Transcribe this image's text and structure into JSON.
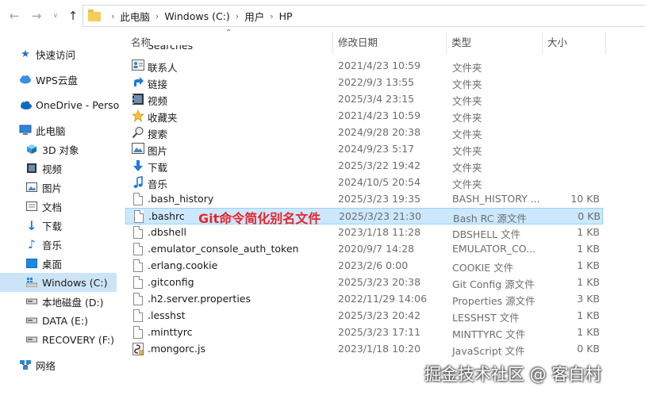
{
  "address_bar": {
    "crumbs": [
      "此电脑",
      "Windows (C:)",
      "用户",
      "HP"
    ]
  },
  "sidebar": {
    "items": [
      {
        "label": "快速访问",
        "icon": "pin-star-icon"
      },
      {
        "label": "WPS云盘",
        "icon": "cloud-icon"
      },
      {
        "label": "OneDrive - Perso",
        "icon": "onedrive-icon"
      },
      {
        "label": "此电脑",
        "icon": "computer-icon"
      },
      {
        "label": "3D 对象",
        "icon": "cube-3d-icon"
      },
      {
        "label": "视频",
        "icon": "video-icon"
      },
      {
        "label": "图片",
        "icon": "picture-icon"
      },
      {
        "label": "文档",
        "icon": "document-icon"
      },
      {
        "label": "下载",
        "icon": "download-icon"
      },
      {
        "label": "音乐",
        "icon": "music-icon"
      },
      {
        "label": "桌面",
        "icon": "desktop-icon"
      },
      {
        "label": "Windows (C:)",
        "icon": "drive-windows-icon",
        "selected": true
      },
      {
        "label": "本地磁盘 (D:)",
        "icon": "drive-icon"
      },
      {
        "label": "DATA (E:)",
        "icon": "drive-icon"
      },
      {
        "label": "RECOVERY (F:)",
        "icon": "drive-icon"
      },
      {
        "label": "网络",
        "icon": "network-icon"
      }
    ]
  },
  "columns": {
    "name": "名称",
    "date": "修改日期",
    "type": "类型",
    "size": "大小"
  },
  "partial_row_name": "Searches",
  "files": [
    {
      "name": "联系人",
      "date": "2021/4/23 10:59",
      "type": "文件夹",
      "size": "",
      "icon": "contacts-icon"
    },
    {
      "name": "链接",
      "date": "2022/9/3 13:55",
      "type": "文件夹",
      "size": "",
      "icon": "link-arrow-icon"
    },
    {
      "name": "视频",
      "date": "2025/3/4 23:15",
      "type": "文件夹",
      "size": "",
      "icon": "video-icon"
    },
    {
      "name": "收藏夹",
      "date": "2021/4/23 10:59",
      "type": "文件夹",
      "size": "",
      "icon": "favorites-star-icon"
    },
    {
      "name": "搜索",
      "date": "2024/9/28 20:38",
      "type": "文件夹",
      "size": "",
      "icon": "search-icon"
    },
    {
      "name": "图片",
      "date": "2024/9/23 5:17",
      "type": "文件夹",
      "size": "",
      "icon": "picture-icon"
    },
    {
      "name": "下载",
      "date": "2025/3/22 19:42",
      "type": "文件夹",
      "size": "",
      "icon": "download-icon"
    },
    {
      "name": "音乐",
      "date": "2024/10/5 20:54",
      "type": "文件夹",
      "size": "",
      "icon": "music-icon"
    },
    {
      "name": ".bash_history",
      "date": "2025/3/23 19:35",
      "type": "BASH_HISTORY ...",
      "size": "10 KB",
      "icon": "file-icon"
    },
    {
      "name": ".bashrc",
      "date": "2025/3/23 21:30",
      "type": "Bash RC 源文件",
      "size": "0 KB",
      "icon": "file-icon",
      "selected": true
    },
    {
      "name": ".dbshell",
      "date": "2023/1/18 11:28",
      "type": "DBSHELL 文件",
      "size": "1 KB",
      "icon": "file-icon"
    },
    {
      "name": ".emulator_console_auth_token",
      "date": "2020/9/7 14:28",
      "type": "EMULATOR_CO...",
      "size": "1 KB",
      "icon": "file-icon"
    },
    {
      "name": ".erlang.cookie",
      "date": "2023/2/6 0:00",
      "type": "COOKIE 文件",
      "size": "1 KB",
      "icon": "file-icon"
    },
    {
      "name": ".gitconfig",
      "date": "2025/3/23 20:38",
      "type": "Git Config 源文件",
      "size": "1 KB",
      "icon": "file-icon"
    },
    {
      "name": ".h2.server.properties",
      "date": "2022/11/29 14:06",
      "type": "Properties 源文件",
      "size": "3 KB",
      "icon": "file-icon"
    },
    {
      "name": ".lesshst",
      "date": "2025/3/23 20:42",
      "type": "LESSHST 文件",
      "size": "1 KB",
      "icon": "file-icon"
    },
    {
      "name": ".minttyrc",
      "date": "2025/3/23 17:11",
      "type": "MINTTYRC 文件",
      "size": "1 KB",
      "icon": "file-icon"
    },
    {
      "name": ".mongorc.js",
      "date": "2023/1/18 10:20",
      "type": "JavaScript 文件",
      "size": "0 KB",
      "icon": "js-script-icon"
    }
  ],
  "annotation": "Git命令简化别名文件",
  "watermark": "掘金技术社区 @ 客白村",
  "colors": {
    "selection_bg": "#cce8ff",
    "selection_border": "#99d1ff",
    "sidebar_selected": "#cce4f7",
    "annotation_red": "#e8262a",
    "folder_yellow": "#f5cd5a"
  }
}
